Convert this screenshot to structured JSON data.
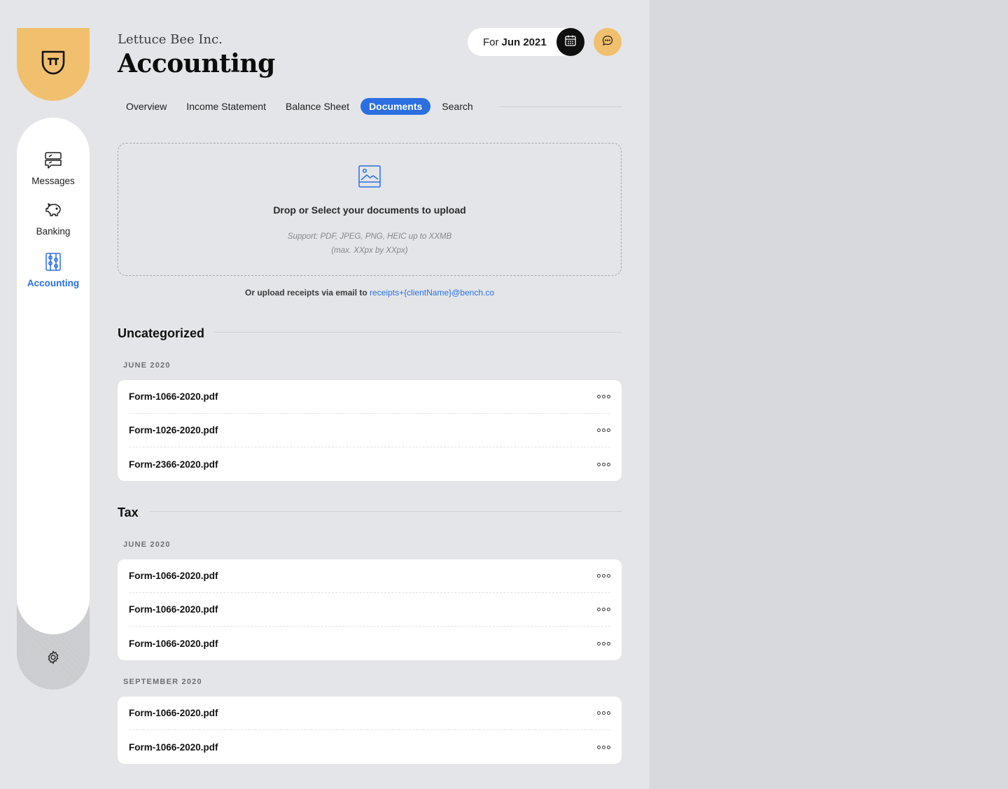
{
  "brand": {
    "accent": "#f1c06e",
    "primary": "#2b6fe0"
  },
  "sidebar": {
    "items": [
      {
        "label": "Messages",
        "icon": "messages-icon",
        "active": false
      },
      {
        "label": "Banking",
        "icon": "piggy-bank-icon",
        "active": false
      },
      {
        "label": "Accounting",
        "icon": "abacus-icon",
        "active": true
      }
    ],
    "settings_icon": "gear-icon"
  },
  "header": {
    "company": "Lettuce Bee Inc.",
    "title": "Accounting",
    "period_prefix": "For",
    "period_value": "Jun 2021"
  },
  "tabs": [
    {
      "label": "Overview",
      "active": false
    },
    {
      "label": "Income Statement",
      "active": false
    },
    {
      "label": "Balance Sheet",
      "active": false
    },
    {
      "label": "Documents",
      "active": true
    },
    {
      "label": "Search",
      "active": false
    }
  ],
  "upload": {
    "title": "Drop or Select your documents to upload",
    "support_line1": "Support: PDF, JPEG, PNG, HEIC up to XXMB",
    "support_line2": "(max. XXpx by XXpx)",
    "email_prefix": "Or upload receipts via email to",
    "email_address": "receipts+{clientName}@bench.co"
  },
  "sections": [
    {
      "title": "Uncategorized",
      "groups": [
        {
          "label": "JUNE 2020",
          "files": [
            "Form-1066-2020.pdf",
            "Form-1026-2020.pdf",
            "Form-2366-2020.pdf"
          ]
        }
      ]
    },
    {
      "title": "Tax",
      "groups": [
        {
          "label": "JUNE 2020",
          "files": [
            "Form-1066-2020.pdf",
            "Form-1066-2020.pdf",
            "Form-1066-2020.pdf"
          ]
        },
        {
          "label": "SEPTEMBER 2020",
          "files": [
            "Form-1066-2020.pdf",
            "Form-1066-2020.pdf"
          ]
        }
      ]
    }
  ]
}
